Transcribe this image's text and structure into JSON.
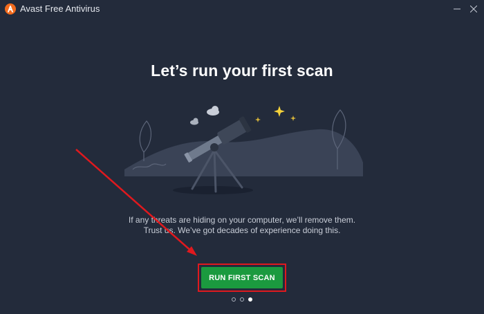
{
  "window": {
    "title": "Avast Free Antivirus",
    "minimize_icon": "minimize-icon",
    "close_icon": "close-icon"
  },
  "main": {
    "heading": "Let’s run your first scan",
    "description_line1": "If any threats are hiding on your computer, we’ll remove them.",
    "description_line2": "Trust us. We’ve got decades of experience doing this.",
    "scan_button_label": "RUN FIRST SCAN"
  },
  "pagination": {
    "count": 3,
    "active_index": 2
  },
  "colors": {
    "background": "#232b3b",
    "accent_orange": "#f26b1d",
    "button_green": "#1b9a3f",
    "annotation_red": "#e0191e"
  },
  "icons": [
    "avast-logo-icon",
    "telescope-illustration",
    "cloud-icon",
    "sparkle-icon",
    "leaf-icon"
  ]
}
